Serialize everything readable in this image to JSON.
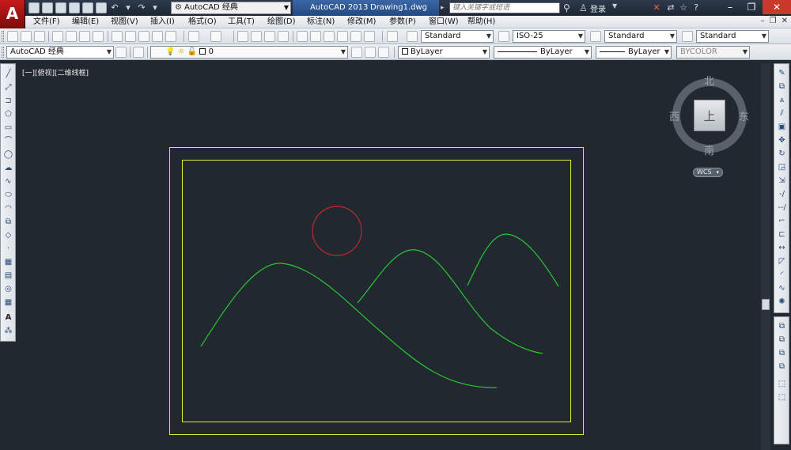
{
  "app": {
    "logo": "A",
    "title": "AutoCAD 2013",
    "document": "Drawing1.dwg"
  },
  "workspace": {
    "current": "AutoCAD 经典"
  },
  "search": {
    "placeholder": "键入关键字或短语"
  },
  "user": {
    "login_label": "登录"
  },
  "menus": [
    "文件(F)",
    "编辑(E)",
    "视图(V)",
    "插入(I)",
    "格式(O)",
    "工具(T)",
    "绘图(D)",
    "标注(N)",
    "修改(M)",
    "参数(P)",
    "窗口(W)",
    "帮助(H)"
  ],
  "styles": {
    "text_style": "Standard",
    "dim_style": "ISO-25",
    "table_style": "Standard",
    "multileader_style": "Standard"
  },
  "layers": {
    "workspace": "AutoCAD 经典",
    "current_layer": "0",
    "color": "ByLayer",
    "linetype": "ByLayer",
    "lineweight": "ByLayer",
    "plot_style": "BYCOLOR"
  },
  "viewport": {
    "label": "[一][俯视][二维线框]"
  },
  "viewcube": {
    "north": "北",
    "south": "南",
    "east": "东",
    "west": "西",
    "face": "上",
    "ucs": "WCS"
  },
  "colors": {
    "background": "#212830",
    "frame": "#e6e62a",
    "sun": "#c0282a",
    "hills": "#28c832"
  },
  "icons": {
    "window_buttons": [
      "close-x-icon",
      "exchange-icon",
      "star-icon",
      "help-icon",
      "minimize-icon",
      "restore-icon",
      "close-icon"
    ]
  }
}
